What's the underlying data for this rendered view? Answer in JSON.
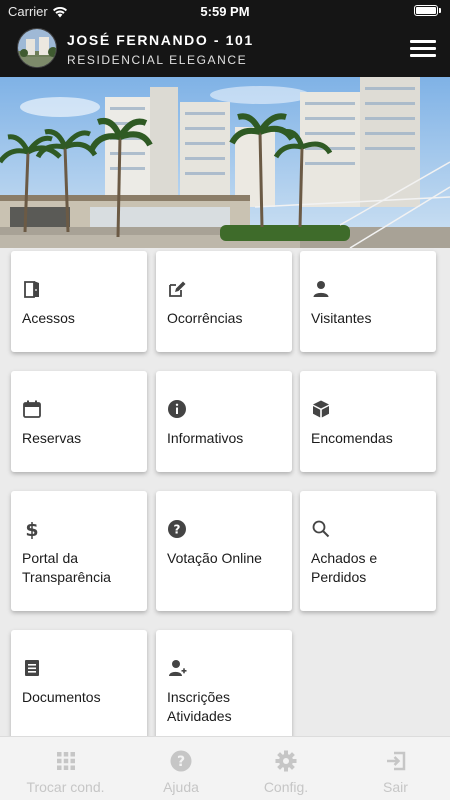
{
  "status_bar": {
    "carrier": "Carrier",
    "time": "5:59 PM"
  },
  "header": {
    "user_line": "JOSÉ FERNANDO - 101",
    "condo_name": "RESIDENCIAL ELEGANCE"
  },
  "colors": {
    "header_bg": "#151515",
    "card_bg": "#ffffff",
    "icon": "#444444",
    "tab_inactive": "#c6c6c6"
  },
  "menu": [
    {
      "label": "Acessos",
      "icon": "door-open-icon"
    },
    {
      "label": "Ocorrências",
      "icon": "edit-note-icon"
    },
    {
      "label": "Visitantes",
      "icon": "person-icon"
    },
    {
      "label": "Reservas",
      "icon": "calendar-icon"
    },
    {
      "label": "Informativos",
      "icon": "info-icon"
    },
    {
      "label": "Encomendas",
      "icon": "package-icon"
    },
    {
      "label": "Portal da Transparência",
      "icon": "dollar-icon"
    },
    {
      "label": "Votação Online",
      "icon": "question-icon"
    },
    {
      "label": "Achados e Perdidos",
      "icon": "search-icon"
    },
    {
      "label": "Documentos",
      "icon": "document-icon"
    },
    {
      "label": "Inscrições Atividades",
      "icon": "person-add-icon"
    }
  ],
  "tabbar": [
    {
      "label": "Trocar cond.",
      "icon": "grid-icon"
    },
    {
      "label": "Ajuda",
      "icon": "help-circle-icon"
    },
    {
      "label": "Config.",
      "icon": "gear-icon"
    },
    {
      "label": "Sair",
      "icon": "logout-icon"
    }
  ]
}
